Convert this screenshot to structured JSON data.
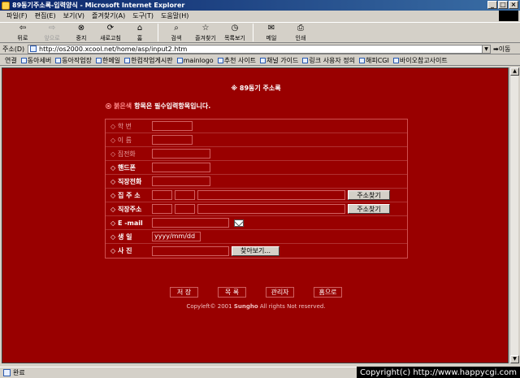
{
  "window": {
    "title": "89동기주소록-입력양식 - Microsoft Internet Explorer",
    "minimize": "_",
    "maximize": "□",
    "close": "×"
  },
  "menu": [
    "파일(F)",
    "편집(E)",
    "보기(V)",
    "즐겨찾기(A)",
    "도구(T)",
    "도움말(H)"
  ],
  "toolbar": {
    "back": "뒤로",
    "forward": "앞으로",
    "stop": "중지",
    "refresh": "새로고침",
    "home": "홈",
    "search": "검색",
    "favorites": "즐겨찾기",
    "history": "목록보기",
    "mail": "메일",
    "print": "인쇄"
  },
  "address": {
    "label": "주소(D)",
    "url": "http://os2000.xcool.net/home/asp/input2.htm",
    "go": "이동"
  },
  "links": {
    "label": "연결",
    "items": [
      "동아세버",
      "동아작업장",
      "한메일",
      "한컴작업게시판",
      "mainlogo",
      "추천 사이트",
      "채널 가이드",
      "링크 사용자 정의",
      "해피CGI",
      "바이오참고사이트"
    ]
  },
  "form": {
    "title": "※ 89동기 주소록",
    "note_prefix": "붉은색",
    "note_suffix": "항목은 필수입력항목입니다.",
    "fields": {
      "student_id": "학 번",
      "name": "이 름",
      "home_phone": "집전화",
      "mobile": "핸드폰",
      "work_phone": "직장전화",
      "home_address": "집 주 소",
      "work_address": "직장주소",
      "email": "E -mail",
      "birthday": "생 일",
      "photo": "사 진"
    },
    "birthday_value": "yyyy/mm/dd",
    "find_address": "주소찾기",
    "browse": "찾아보기..."
  },
  "actions": {
    "save": "저 장",
    "list": "목 록",
    "admin": "관리자",
    "home": "홈으로"
  },
  "copyright_prefix": "Copyleft© 2001",
  "copyright_author": "Sungho",
  "copyright_suffix": "All rights Not reserved.",
  "status": "완료",
  "watermark": "Copyright(c) http://www.happycgi.com"
}
